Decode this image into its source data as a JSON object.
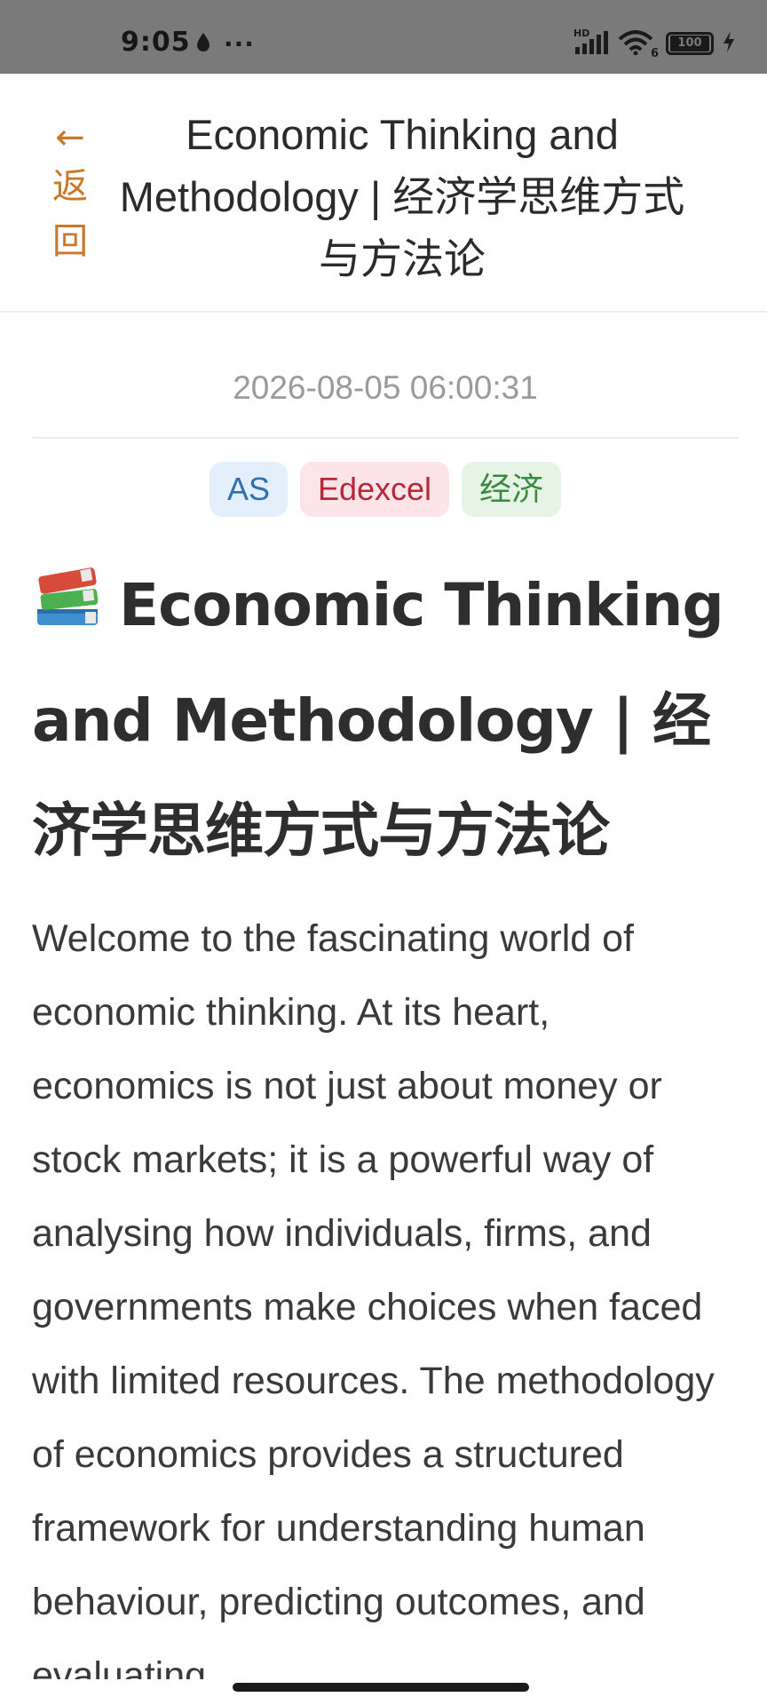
{
  "status_bar": {
    "time": "9:05",
    "more": "···",
    "network_label": "HD",
    "wifi_label": "6",
    "battery": "100"
  },
  "header": {
    "back_arrow": "←",
    "back_label": "返回",
    "title": "Economic Thinking and Methodology | 经济学思维方式与方法论"
  },
  "article": {
    "timestamp": "2026-08-05 06:00:31",
    "tags": [
      {
        "label": "AS",
        "color": "#2f6fb4",
        "bg": "#e3f0fb"
      },
      {
        "label": "Edexcel",
        "color": "#b5283a",
        "bg": "#fce4e8"
      },
      {
        "label": "经济",
        "color": "#3a8a3f",
        "bg": "#e6f4e6"
      }
    ],
    "title_icon": "books-icon",
    "title": "Economic Thinking and Methodology | 经济学思维方式与方法论",
    "body": "Welcome to the fascinating world of economic thinking. At its heart, economics is not just about money or stock markets; it is a powerful way of analysing how individuals, firms, and governments make choices when faced with limited resources. The methodology of economics provides a structured framework for understanding human behaviour, predicting outcomes, and evaluating"
  },
  "colors": {
    "accent": "#c8782a",
    "status_bar_bg": "#7a7a7a",
    "text_primary": "#2e2e2e",
    "text_muted": "#9a9a9a"
  }
}
